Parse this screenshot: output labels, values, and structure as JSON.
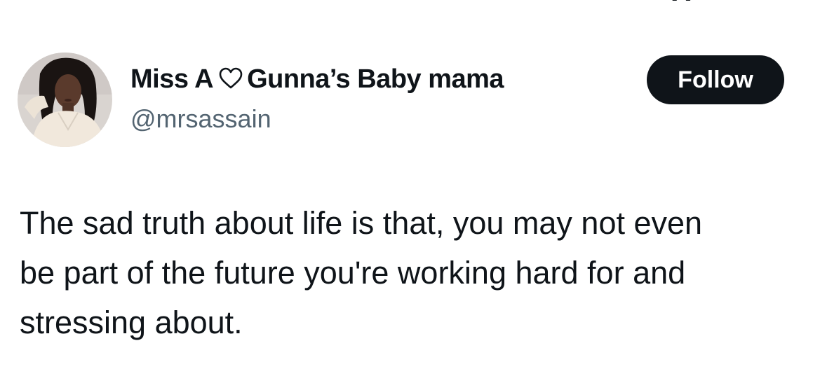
{
  "header": {
    "partial_logo_text": "X"
  },
  "author": {
    "display_name_first": "Miss A",
    "display_name_second": "Gunna’s Baby mama",
    "handle": "@mrsassain",
    "avatar_icon": "avatar-photo",
    "heart_icon": "outline-heart-icon"
  },
  "follow_button": {
    "label": "Follow"
  },
  "tweet": {
    "lines": [
      "The sad truth about life is that, you may not even",
      "be part of the future you're working hard for and",
      "stressing about."
    ]
  },
  "colors": {
    "text_primary": "#0f1419",
    "text_secondary": "#536471",
    "button_bg": "#0f1419",
    "button_text": "#ffffff",
    "background": "#ffffff"
  }
}
